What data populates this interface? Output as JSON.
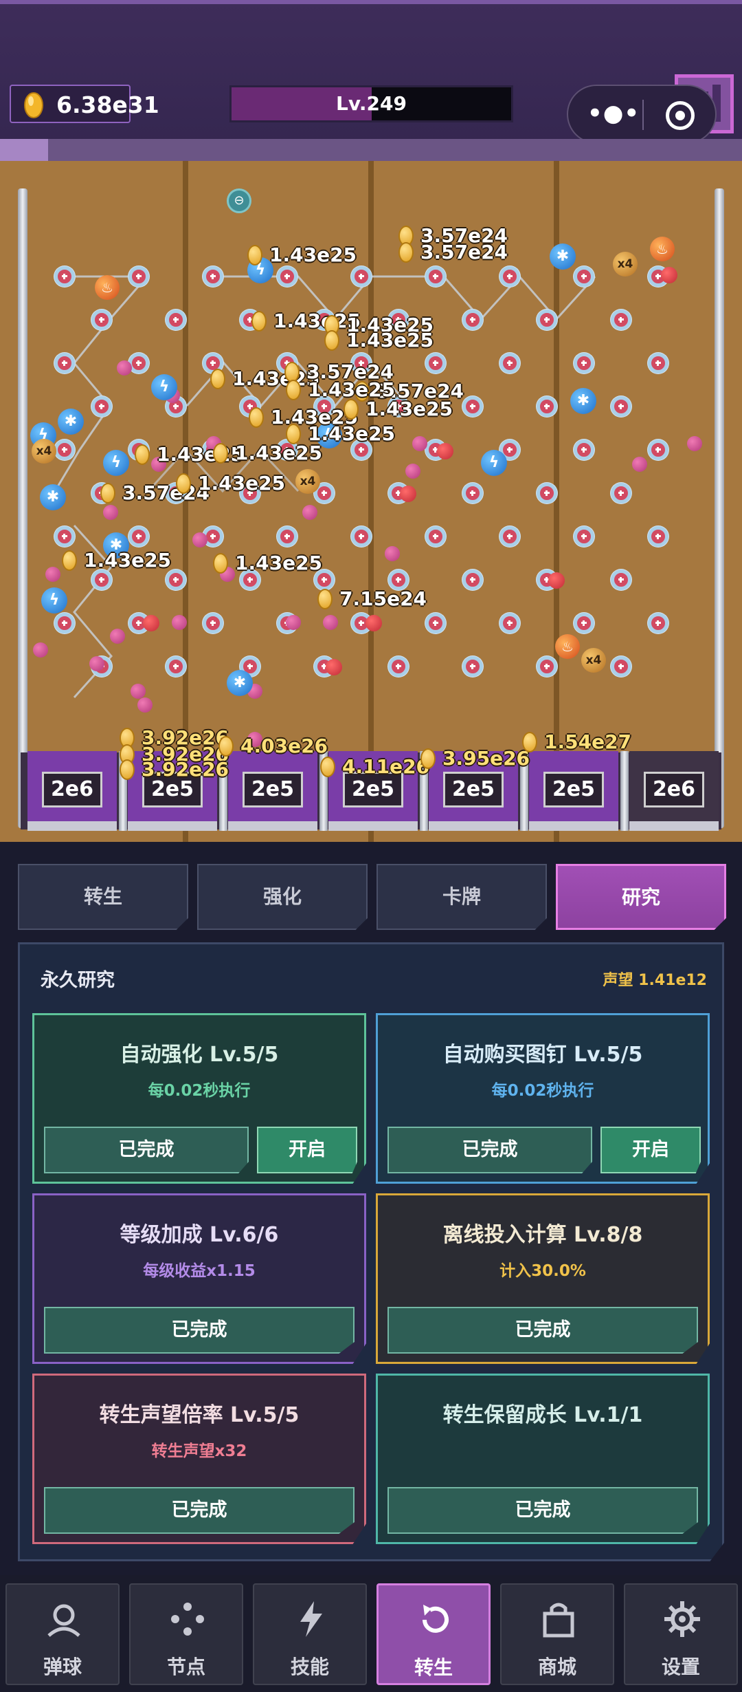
{
  "header": {
    "coins": "6.38e31",
    "level": "Lv.249",
    "level_progress": 0.5,
    "stage_progress": 0.065,
    "menu_dots": "•●•"
  },
  "board": {
    "slots": [
      {
        "value": "2e6",
        "active": true
      },
      {
        "value": "2e5",
        "active": true
      },
      {
        "value": "2e5",
        "active": true
      },
      {
        "value": "2e5",
        "active": true
      },
      {
        "value": "2e5",
        "active": true
      },
      {
        "value": "2e5",
        "active": true
      },
      {
        "value": "2e6",
        "active": false
      }
    ],
    "floating_rewards": [
      {
        "text": "3.57e24",
        "gold": false
      },
      {
        "text": "3.57e24",
        "gold": false
      },
      {
        "text": "1.43e25",
        "gold": false
      },
      {
        "text": "1.43e25",
        "gold": false
      },
      {
        "text": "1.43e25",
        "gold": false
      },
      {
        "text": "1.43e25",
        "gold": false
      },
      {
        "text": "1.43e25",
        "gold": false
      },
      {
        "text": "3.57e24",
        "gold": false
      },
      {
        "text": "3.57e24",
        "gold": false
      },
      {
        "text": "1.43e25",
        "gold": false
      },
      {
        "text": "1.43e25",
        "gold": false
      },
      {
        "text": "1.43e25",
        "gold": false
      },
      {
        "text": "1.43e25",
        "gold": false
      },
      {
        "text": "1.43e25",
        "gold": false
      },
      {
        "text": "3.57e24",
        "gold": false
      },
      {
        "text": "1.43e25",
        "gold": false
      },
      {
        "text": "1.43e25",
        "gold": false
      },
      {
        "text": "1.43e25",
        "gold": false
      },
      {
        "text": "1.43e25",
        "gold": false
      },
      {
        "text": "7.15e24",
        "gold": false
      },
      {
        "text": "3.92e26",
        "gold": true
      },
      {
        "text": "3.92e26",
        "gold": true
      },
      {
        "text": "3.92e26",
        "gold": true
      },
      {
        "text": "4.03e26",
        "gold": true
      },
      {
        "text": "4.11e26",
        "gold": true
      },
      {
        "text": "3.95e26",
        "gold": true
      },
      {
        "text": "1.54e27",
        "gold": true
      }
    ],
    "multiplier_label": "x4"
  },
  "tabs": [
    {
      "label": "转生",
      "active": false
    },
    {
      "label": "强化",
      "active": false
    },
    {
      "label": "卡牌",
      "active": false
    },
    {
      "label": "研究",
      "active": true
    }
  ],
  "panel": {
    "title": "永久研究",
    "prestige": "声望 1.41e12",
    "cards": [
      {
        "title": "自动强化 Lv.5/5",
        "sub": "每0.02秒执行",
        "btn": "已完成",
        "toggle": "开启",
        "theme": "green"
      },
      {
        "title": "自动购买图钉 Lv.5/5",
        "sub": "每0.02秒执行",
        "btn": "已完成",
        "toggle": "开启",
        "theme": "blue"
      },
      {
        "title": "等级加成 Lv.6/6",
        "sub": "每级收益x1.15",
        "btn": "已完成",
        "theme": "purple"
      },
      {
        "title": "离线投入计算 Lv.8/8",
        "sub": "计入30.0%",
        "btn": "已完成",
        "theme": "gold"
      },
      {
        "title": "转生声望倍率 Lv.5/5",
        "sub": "转生声望x32",
        "btn": "已完成",
        "theme": "red"
      },
      {
        "title": "转生保留成长 Lv.1/1",
        "sub": "",
        "btn": "已完成",
        "theme": "teal"
      }
    ],
    "colors": {
      "green": {
        "bg": "#1d3d39",
        "border": "#5ec39a",
        "title": "#d8f0e6",
        "sub": "#6ad3a6"
      },
      "blue": {
        "bg": "#1c3445",
        "border": "#4fa0d6",
        "title": "#d8ecf8",
        "sub": "#5fb3ee"
      },
      "purple": {
        "bg": "#2c2746",
        "border": "#8a62c6",
        "title": "#e6ddf6",
        "sub": "#b38be8"
      },
      "gold": {
        "bg": "#2b2c33",
        "border": "#d9a839",
        "title": "#f3ead3",
        "sub": "#f0c24a"
      },
      "red": {
        "bg": "#33263a",
        "border": "#d06a7c",
        "title": "#f2dde2",
        "sub": "#f07e93"
      },
      "teal": {
        "bg": "#1d3a3d",
        "border": "#4fb7a8",
        "title": "#d6eeea",
        "sub": "#6ad3c4"
      }
    }
  },
  "nav": [
    {
      "label": "弹球",
      "icon": "ball-icon",
      "active": false
    },
    {
      "label": "节点",
      "icon": "nodes-icon",
      "active": false
    },
    {
      "label": "技能",
      "icon": "lightning-icon",
      "active": false
    },
    {
      "label": "转生",
      "icon": "rebirth-icon",
      "active": true
    },
    {
      "label": "商城",
      "icon": "shop-bag-icon",
      "active": false
    },
    {
      "label": "设置",
      "icon": "gear-icon",
      "active": false
    }
  ]
}
